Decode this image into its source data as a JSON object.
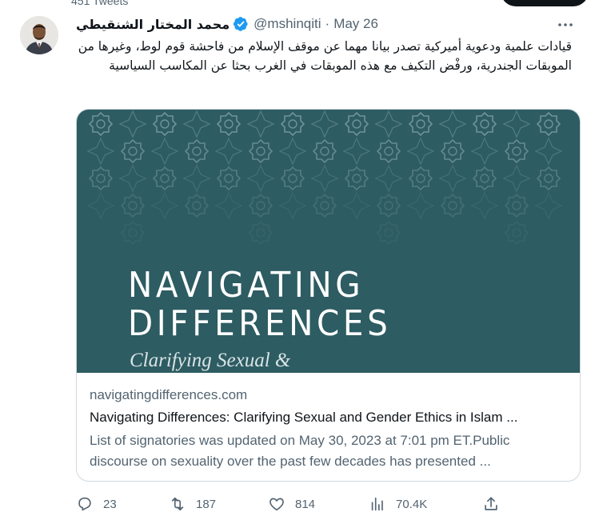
{
  "profile_header": {
    "tweets_count": "451 Tweets"
  },
  "tweet": {
    "display_name": "محمد المختار الشنقيطي",
    "handle": "@mshinqiti",
    "separator": "·",
    "timestamp": "May 26",
    "text": "قيادات علمية ودعوية أميركية تصدر بيانا مهما عن موقف الإسلام من فاحشة قوم لوط، وغيرها من الموبقات الجندرية، ورفْض التكيف مع هذه الموبقات في الغرب بحثا عن المكاسب السياسية",
    "card": {
      "image_title_line1": "NAVIGATING",
      "image_title_line2": "DIFFERENCES",
      "image_subtitle": "Clarifying Sexual &",
      "domain": "navigatingdifferences.com",
      "title": "Navigating Differences: Clarifying Sexual and Gender Ethics in Islam ...",
      "description": "List of signatories was updated on May 30, 2023 at 7:01 pm ET.Public discourse on sexuality over the past few decades has presented ..."
    },
    "actions": {
      "replies": "23",
      "retweets": "187",
      "likes": "814",
      "views": "70.4K"
    }
  },
  "colors": {
    "text_primary": "#0f1419",
    "text_secondary": "#536471",
    "verified_blue": "#1d9bf0",
    "card_image_bg": "#2d5c62",
    "card_border": "#cfd9de"
  },
  "icons": {
    "verified": "verified-badge-icon",
    "more": "more-dots-icon",
    "reply": "reply-icon",
    "retweet": "retweet-icon",
    "like": "heart-icon",
    "views": "views-chart-icon",
    "share": "share-icon"
  }
}
